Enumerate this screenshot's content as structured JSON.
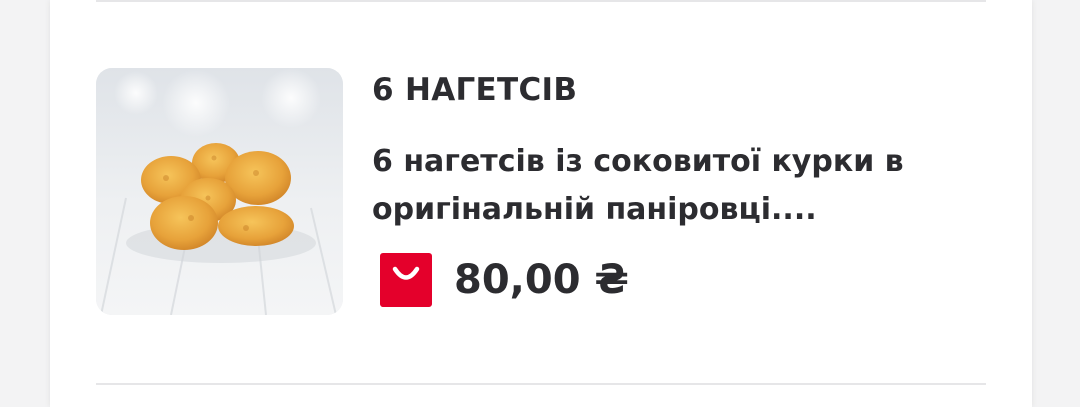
{
  "product": {
    "title": "6 НАГЕТСІВ",
    "description": "6 нагетсів із соковитої курки в оригінальній паніровці....",
    "price": "80,00 ₴",
    "image": "chicken-nuggets-photo"
  },
  "icons": {
    "add_to_cart": "shopping-bag-icon"
  },
  "colors": {
    "accent": "#e4002b",
    "text": "#2c2c30",
    "divider": "#e6e6e8"
  }
}
